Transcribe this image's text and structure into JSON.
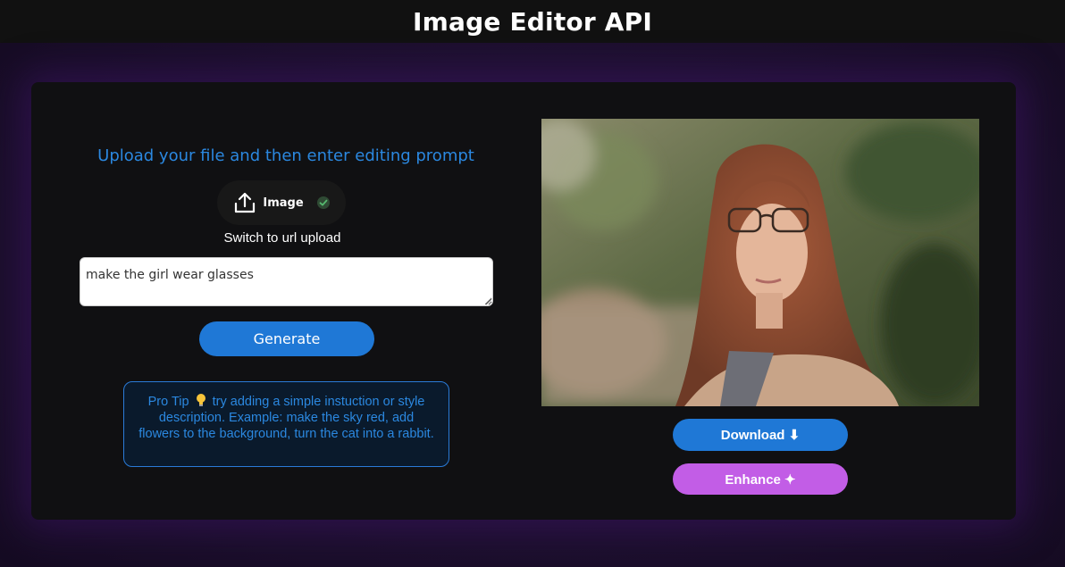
{
  "header": {
    "title": "Image Editor API"
  },
  "editor": {
    "instruction": "Upload your file and then enter editing prompt",
    "upload_label": "Image",
    "switch_label": "Switch to url upload",
    "prompt_value": "make the girl wear glasses",
    "generate_label": "Generate",
    "tip_prefix": "Pro Tip",
    "tip_text": "try adding a simple instuction or style description. Example: make the sky red, add flowers to the background, turn the cat into a rabbit."
  },
  "result": {
    "download_label": "Download ⬇",
    "enhance_label": "Enhance ✦"
  },
  "colors": {
    "accent_blue": "#1f78d6",
    "enhance_purple": "#c25de6",
    "upload_check_green": "#3aa15a"
  },
  "icons": {
    "upload": "upload-icon",
    "check": "check-circle-icon",
    "tip": "lightbulb-icon"
  }
}
